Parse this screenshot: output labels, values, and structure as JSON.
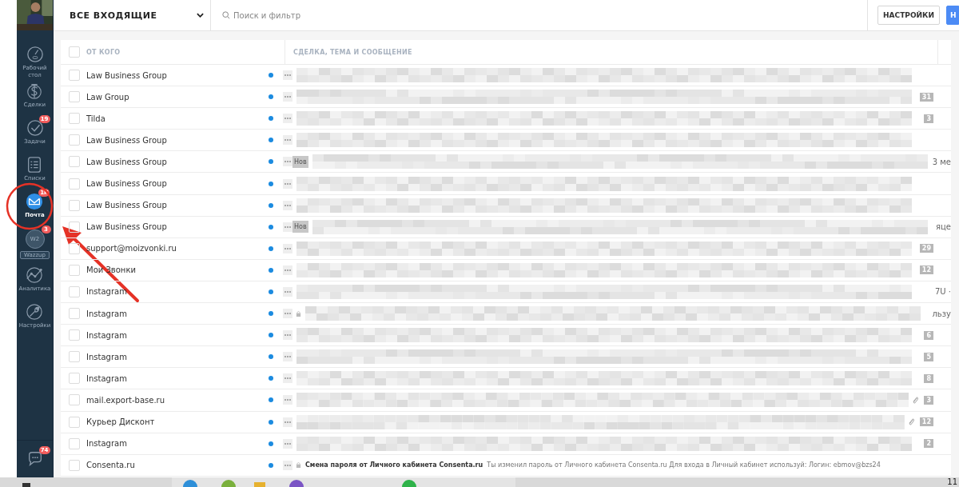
{
  "sidebar": {
    "items": [
      {
        "kind": "dashboard",
        "label": "Рабочий стол",
        "selected": false
      },
      {
        "kind": "deals",
        "label": "Сделки",
        "selected": false
      },
      {
        "kind": "tasks",
        "label": "Задачи",
        "badge": "19",
        "selected": false
      },
      {
        "kind": "lists",
        "label": "Списки",
        "selected": false
      },
      {
        "kind": "mail",
        "label": "Почта",
        "badge": "1K",
        "selected": true
      },
      {
        "kind": "wazzup",
        "label": "Wazzup",
        "avatar": "W2",
        "badge": "3",
        "selected": false
      },
      {
        "kind": "analytics",
        "label": "Аналитика",
        "selected": false
      },
      {
        "kind": "settings",
        "label": "Настройки",
        "selected": false
      }
    ],
    "chat": {
      "badge": "74"
    }
  },
  "header": {
    "folder": "ВСЕ ВХОДЯЩИЕ",
    "search": {
      "placeholder": "Поиск и фильтр"
    },
    "buttons": [
      "НАСТРОЙКИ",
      "Н"
    ]
  },
  "table": {
    "select_all_checked": false,
    "columns": [
      "ОТ КОГО",
      "СДЕЛКА, ТЕМА И СООБЩЕНИЕ"
    ],
    "rows": [
      {
        "kind": "redacted",
        "sender": "Law Business Group",
        "checked": false,
        "unread": true,
        "locked": false,
        "attachment": false
      },
      {
        "kind": "redacted",
        "sender": "Law Group",
        "checked": false,
        "unread": true,
        "locked": false,
        "attachment": false,
        "count": "31"
      },
      {
        "kind": "redacted",
        "sender": "Tilda",
        "checked": false,
        "unread": true,
        "locked": false,
        "attachment": false,
        "count": "3"
      },
      {
        "kind": "redacted",
        "sender": "Law Business Group",
        "checked": false,
        "unread": true,
        "locked": false,
        "attachment": false
      },
      {
        "kind": "redacted",
        "sender": "Law Business Group",
        "checked": false,
        "unread": true,
        "locked": false,
        "attachment": false,
        "tag": "Нов",
        "tail": "3 ме"
      },
      {
        "kind": "redacted",
        "sender": "Law Business Group",
        "checked": false,
        "unread": true,
        "locked": false,
        "attachment": false
      },
      {
        "kind": "redacted",
        "sender": "Law Business Group",
        "checked": false,
        "unread": true,
        "locked": false,
        "attachment": false
      },
      {
        "kind": "redacted",
        "sender": "Law Business Group",
        "checked": false,
        "unread": true,
        "locked": false,
        "attachment": false,
        "tag": "Нов",
        "tail": "яце"
      },
      {
        "kind": "redacted",
        "sender": "support@moizvonki.ru",
        "checked": false,
        "unread": true,
        "locked": false,
        "attachment": false,
        "count": "29"
      },
      {
        "kind": "redacted",
        "sender": "Мои Звонки",
        "checked": false,
        "unread": true,
        "locked": false,
        "attachment": false,
        "count": "12"
      },
      {
        "kind": "redacted",
        "sender": "Instagram",
        "checked": false,
        "unread": true,
        "locked": false,
        "attachment": false,
        "tail": "7U ·"
      },
      {
        "kind": "redacted",
        "sender": "Instagram",
        "checked": false,
        "unread": true,
        "locked": true,
        "attachment": false,
        "tail": "льзу"
      },
      {
        "kind": "redacted",
        "sender": "Instagram",
        "checked": false,
        "unread": true,
        "locked": false,
        "attachment": false,
        "count": "6"
      },
      {
        "kind": "redacted",
        "sender": "Instagram",
        "checked": false,
        "unread": true,
        "locked": false,
        "attachment": false,
        "count": "5"
      },
      {
        "kind": "redacted",
        "sender": "Instagram",
        "checked": false,
        "unread": true,
        "locked": false,
        "attachment": false,
        "count": "8"
      },
      {
        "kind": "redacted",
        "sender": "mail.export-base.ru",
        "checked": false,
        "unread": true,
        "locked": false,
        "attachment": true,
        "count": "3"
      },
      {
        "kind": "redacted",
        "sender": "Курьер Дисконт",
        "checked": false,
        "unread": true,
        "locked": false,
        "attachment": true,
        "count": "12"
      },
      {
        "kind": "redacted",
        "sender": "Instagram",
        "checked": false,
        "unread": true,
        "locked": false,
        "attachment": false,
        "count": "2"
      },
      {
        "kind": "message",
        "sender": "Consenta.ru",
        "checked": false,
        "unread": true,
        "locked": true,
        "attachment": false,
        "subject": "Смена пароля от Личного кабинета Consenta.ru",
        "preview": "Ты изменил пароль от Личного кабинета Consenta.ru Для входа в Личный кабинет используй: Логин: ebmov@bzs24"
      }
    ]
  },
  "taskbar": {
    "clock": "11"
  }
}
